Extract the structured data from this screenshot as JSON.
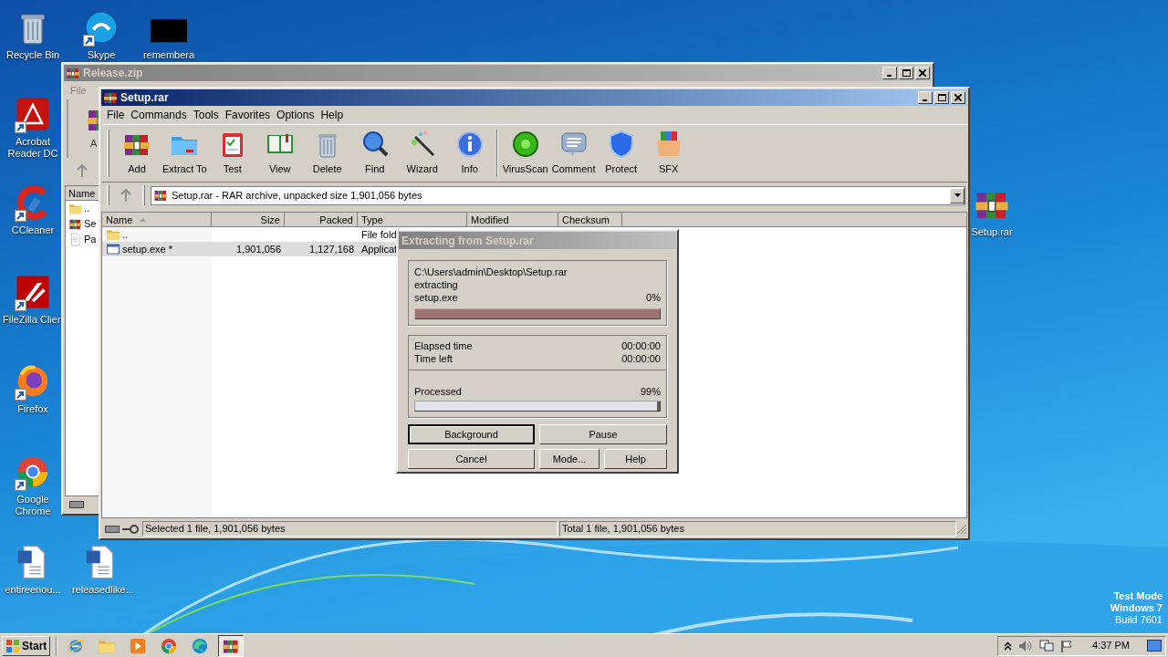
{
  "desktop": {
    "icons": [
      {
        "label": "Recycle Bin",
        "kind": "trash",
        "shortcut": false
      },
      {
        "label": "Skype",
        "kind": "chat",
        "shortcut": true
      },
      {
        "label": "remembera",
        "kind": "blank",
        "shortcut": false
      },
      {
        "label": "Acrobat Reader DC",
        "kind": "pdf",
        "shortcut": true
      },
      {
        "label": "CCleaner",
        "kind": "cleaner",
        "shortcut": true
      },
      {
        "label": "FileZilla Clien",
        "kind": "ftp",
        "shortcut": true
      },
      {
        "label": "Firefox",
        "kind": "fox",
        "shortcut": true
      },
      {
        "label": "Google Chrome",
        "kind": "chrome",
        "shortcut": true
      },
      {
        "label": "entireenou...",
        "kind": "doc",
        "shortcut": false
      },
      {
        "label": "releasedlike...",
        "kind": "doc",
        "shortcut": false
      },
      {
        "label": "Setup.rar",
        "kind": "rar",
        "shortcut": false
      }
    ]
  },
  "background_window": {
    "title": "Release.zip",
    "menu": [
      "File"
    ],
    "toolbar_label": "A",
    "column": "Name",
    "rows": [
      {
        "name": "..",
        "kind": "folder"
      },
      {
        "name": "Se",
        "kind": "rar"
      },
      {
        "name": "Pa",
        "kind": "text"
      }
    ]
  },
  "main_window": {
    "title": "Setup.rar",
    "menu": [
      "File",
      "Commands",
      "Tools",
      "Favorites",
      "Options",
      "Help"
    ],
    "toolbar": [
      [
        {
          "label": "Add",
          "kind": "add"
        },
        {
          "label": "Extract To",
          "kind": "extract"
        },
        {
          "label": "Test",
          "kind": "test"
        },
        {
          "label": "View",
          "kind": "view"
        },
        {
          "label": "Delete",
          "kind": "delete"
        },
        {
          "label": "Find",
          "kind": "find"
        },
        {
          "label": "Wizard",
          "kind": "wizard"
        },
        {
          "label": "Info",
          "kind": "info"
        }
      ],
      [
        {
          "label": "VirusScan",
          "kind": "virus"
        },
        {
          "label": "Comment",
          "kind": "comment"
        },
        {
          "label": "Protect",
          "kind": "protect"
        },
        {
          "label": "SFX",
          "kind": "sfx"
        }
      ]
    ],
    "address": "Setup.rar - RAR archive, unpacked size 1,901,056 bytes",
    "columns": [
      {
        "label": "Name",
        "sorted": true
      },
      {
        "label": "Size",
        "sorted": false
      },
      {
        "label": "Packed",
        "sorted": false
      },
      {
        "label": "Type",
        "sorted": false
      },
      {
        "label": "Modified",
        "sorted": false
      },
      {
        "label": "Checksum",
        "sorted": false
      }
    ],
    "rows": [
      {
        "name": "..",
        "kind": "folder",
        "type": "File fold",
        "selected": false
      },
      {
        "name": "setup.exe *",
        "kind": "exe",
        "size": "1,901,056",
        "packed": "1,127,168",
        "type": "Applicat",
        "selected": true
      }
    ],
    "status": [
      "Selected 1 file, 1,901,056 bytes",
      "Total 1 file, 1,901,056 bytes"
    ]
  },
  "dialog": {
    "title": "Extracting from Setup.rar",
    "archive": "C:\\Users\\admin\\Desktop\\Setup.rar",
    "action": "extracting",
    "file": "setup.exe",
    "file_progress": {
      "percent": "0%",
      "level": 0
    },
    "times": [
      {
        "label": "Elapsed time",
        "value": "00:00:00"
      },
      {
        "label": "Time left",
        "value": "00:00:00"
      }
    ],
    "processed": {
      "label": "Processed",
      "percent": "99%",
      "level": 0.99
    },
    "buttons": [
      {
        "label": "Background",
        "focused": true
      },
      {
        "label": "Pause",
        "focused": false
      },
      {
        "label": "Cancel",
        "focused": false
      },
      {
        "label": "Mode...",
        "focused": false
      },
      {
        "label": "Help",
        "focused": false
      }
    ]
  },
  "os_notice": [
    "Test Mode",
    "Windows 7",
    "Build 7601"
  ],
  "taskbar": {
    "start": "Start",
    "apps": [
      {
        "kind": "ie",
        "active": false
      },
      {
        "kind": "folder",
        "active": false
      },
      {
        "kind": "media",
        "active": false
      },
      {
        "kind": "chrome",
        "active": false
      },
      {
        "kind": "edge",
        "active": false
      },
      {
        "kind": "rar",
        "active": true
      }
    ],
    "clock": "4:37 PM"
  }
}
